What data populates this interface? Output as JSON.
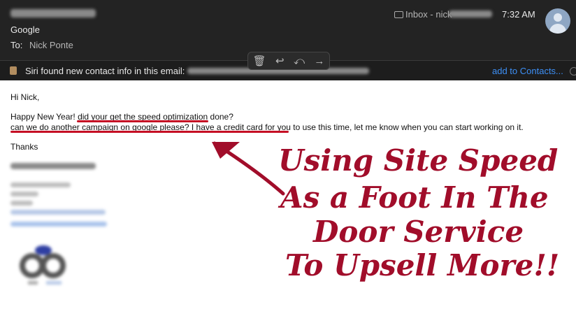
{
  "header": {
    "from_name": "Google",
    "to_label": "To:",
    "to_name": "Nick Ponte",
    "mailbox": "Inbox - nick",
    "time": "7:32 AM"
  },
  "toolbar": {
    "items": [
      {
        "name": "trash-button",
        "glyph": "🗑"
      },
      {
        "name": "reply-button",
        "glyph": "↩"
      },
      {
        "name": "reply-all-button",
        "glyph": "⤺"
      },
      {
        "name": "forward-button",
        "glyph": "→"
      }
    ]
  },
  "siri": {
    "text": "Siri found new contact info in this email:",
    "link": "add to Contacts..."
  },
  "email": {
    "greeting": "Hi Nick,",
    "line1_a": "Happy New Year! ",
    "line1_b": "did your get the speed optimization",
    "line1_c": " done?",
    "line2_a": "can we do another campaign on google please? I have a credit card for you",
    "line2_b": " to use this time, let me know when you can start working on it.",
    "signoff": "Thanks"
  },
  "callout": {
    "line1": "Using Site Speed",
    "line2": "As a Foot In The",
    "line3": "Door Service",
    "line4": "To Upsell More!!"
  },
  "colors": {
    "accent": "#a10d2a",
    "underline": "#c50f24",
    "link": "#3d8ff5"
  }
}
